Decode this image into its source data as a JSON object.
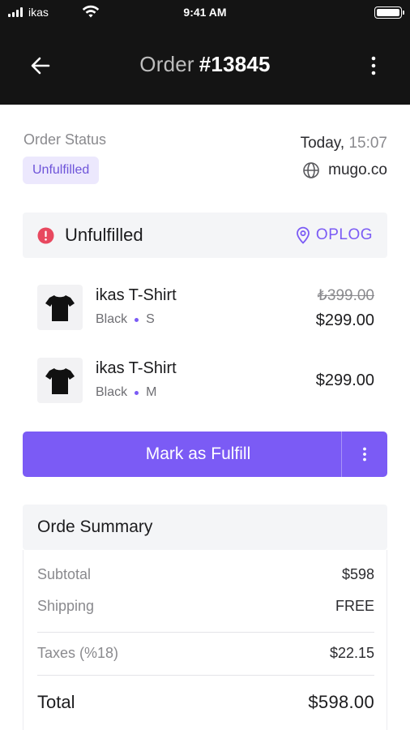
{
  "status_bar": {
    "carrier": "ikas",
    "time": "9:41 AM"
  },
  "nav": {
    "title_label": "Order",
    "order_number": "#13845",
    "back_icon": "arrow-left-icon",
    "more_icon": "more-vertical-icon"
  },
  "order": {
    "status_label": "Order Status",
    "status_badge": "Unfulfilled",
    "date": "Today,",
    "time": "15:07",
    "store": "mugo.co"
  },
  "fulfillment": {
    "title": "Unfulfilled",
    "location": "OPLOG"
  },
  "products": [
    {
      "name": "ikas T-Shirt",
      "color": "Black",
      "size": "S",
      "old_price": "₺399.00",
      "price": "$299.00"
    },
    {
      "name": "ikas T-Shirt",
      "color": "Black",
      "size": "M",
      "price": "$299.00"
    }
  ],
  "action": {
    "label": "Mark as Fulfill"
  },
  "summary": {
    "title": "Orde Summary",
    "subtotal_label": "Subtotal",
    "subtotal": "$598",
    "shipping_label": "Shipping",
    "shipping": "FREE",
    "taxes_label": "Taxes (%18)",
    "taxes": "$22.15",
    "total_label": "Total",
    "total": "$598.00"
  },
  "colors": {
    "header_bg": "#141414",
    "accent": "#7b5bf5",
    "badge_bg": "#ece8fd",
    "alert": "#e8485f"
  }
}
